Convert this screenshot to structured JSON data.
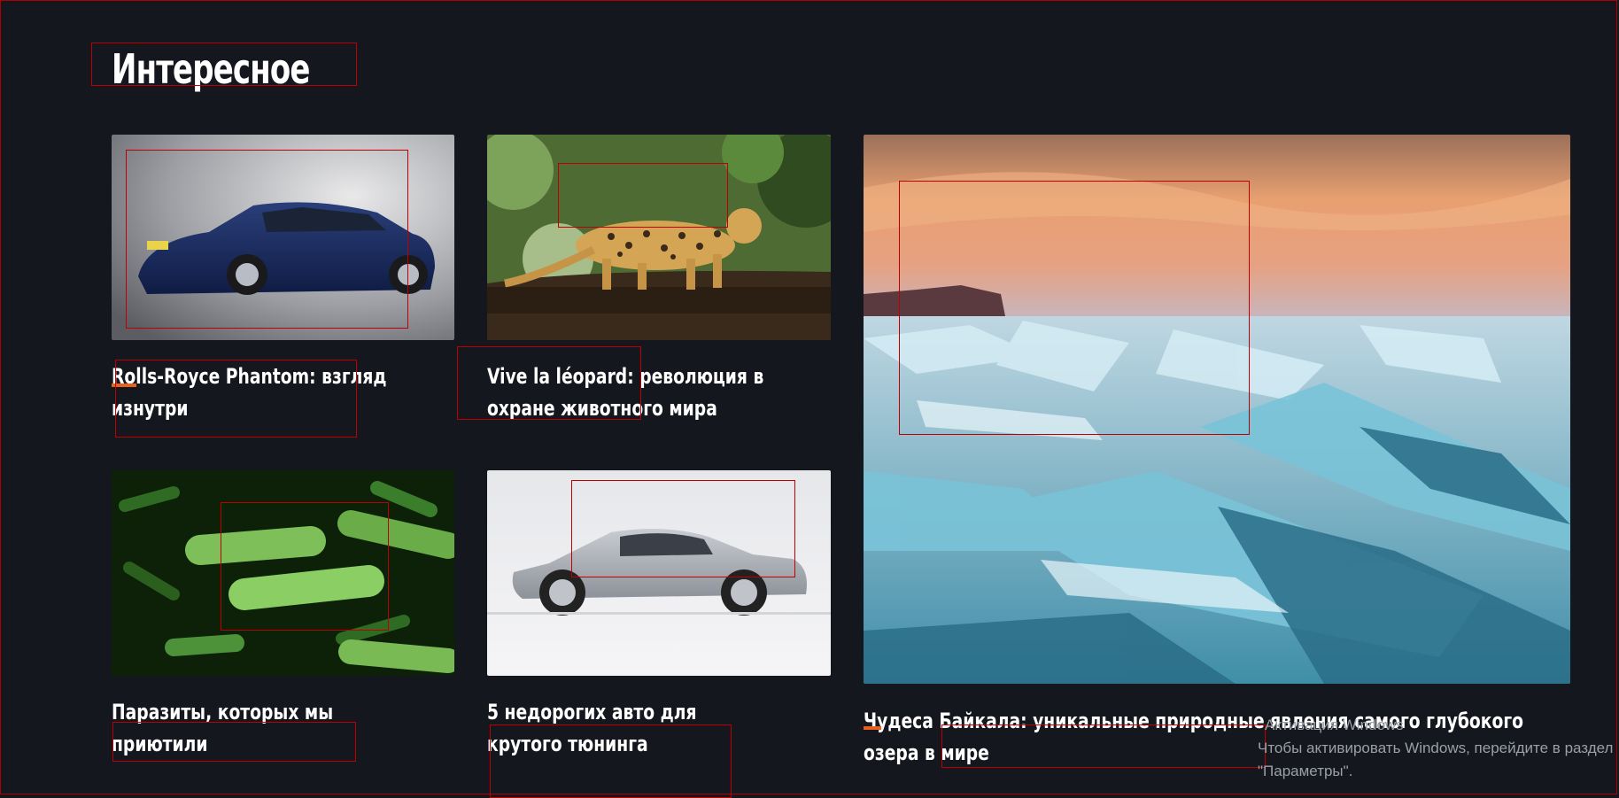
{
  "section": {
    "title": "Интересное"
  },
  "cards": [
    {
      "title": "Rolls-Royce Phantom: взгляд изнутри",
      "image": "blue-luxury-sedan"
    },
    {
      "title": "Vive la léopard: революция в охране животного мира",
      "image": "leopard-on-branch"
    },
    {
      "title": "Паразиты, которых мы приютили",
      "image": "green-bacteria"
    },
    {
      "title": "5 недорогих авто для крутого тюнинга",
      "image": "silver-sports-car"
    },
    {
      "title": "Чудеса Байкала: уникальные природные явления самого глубокого озера в мире",
      "image": "baikal-ice-sunset"
    }
  ],
  "watermark": {
    "line1": "Активация Windows",
    "line2": "Чтобы активировать Windows, перейдите в раздел",
    "line3": "\"Параметры\"."
  },
  "colors": {
    "background": "#14171d",
    "accent": "#e8601c",
    "text": "#ffffff"
  }
}
